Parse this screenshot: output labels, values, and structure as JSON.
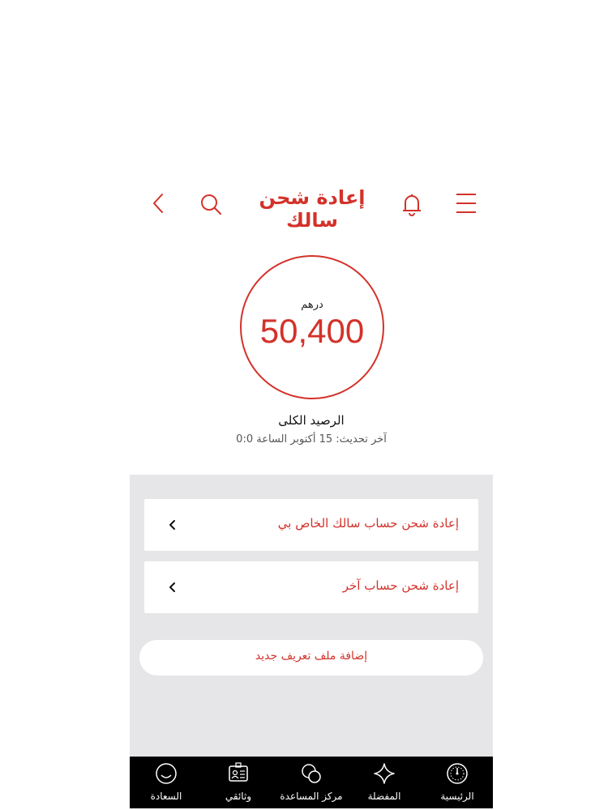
{
  "header": {
    "title": "إعادة شحن سالك",
    "icons": {
      "menu": "menu-icon",
      "notifications": "bell-icon",
      "search": "search-icon",
      "back": "back-icon"
    }
  },
  "balance": {
    "currency": "درهم",
    "amount": "50,400",
    "label": "الرصيد الكلى",
    "last_update": "آخر تحديث: 15 أكتوبر الساعة 0:0"
  },
  "actions": [
    {
      "label": "إعادة شحن حساب سالك الخاص بي"
    },
    {
      "label": "إعادة شحن حساب آخر"
    }
  ],
  "add_profile_label": "إضافة ملف تعريف جديد",
  "tabbar": {
    "items": [
      {
        "label": "الرئيسية",
        "icon": "speedometer-icon"
      },
      {
        "label": "المفضلة",
        "icon": "star-sparkle-icon"
      },
      {
        "label": "مركز المساعدة",
        "icon": "chat-bubbles-icon"
      },
      {
        "label": "وثائقي",
        "icon": "id-card-icon"
      },
      {
        "label": "السعادة",
        "icon": "smiley-icon"
      }
    ]
  },
  "colors": {
    "accent": "#d3322a",
    "background_grey": "#e6e6e8",
    "tabbar": "#000000"
  }
}
